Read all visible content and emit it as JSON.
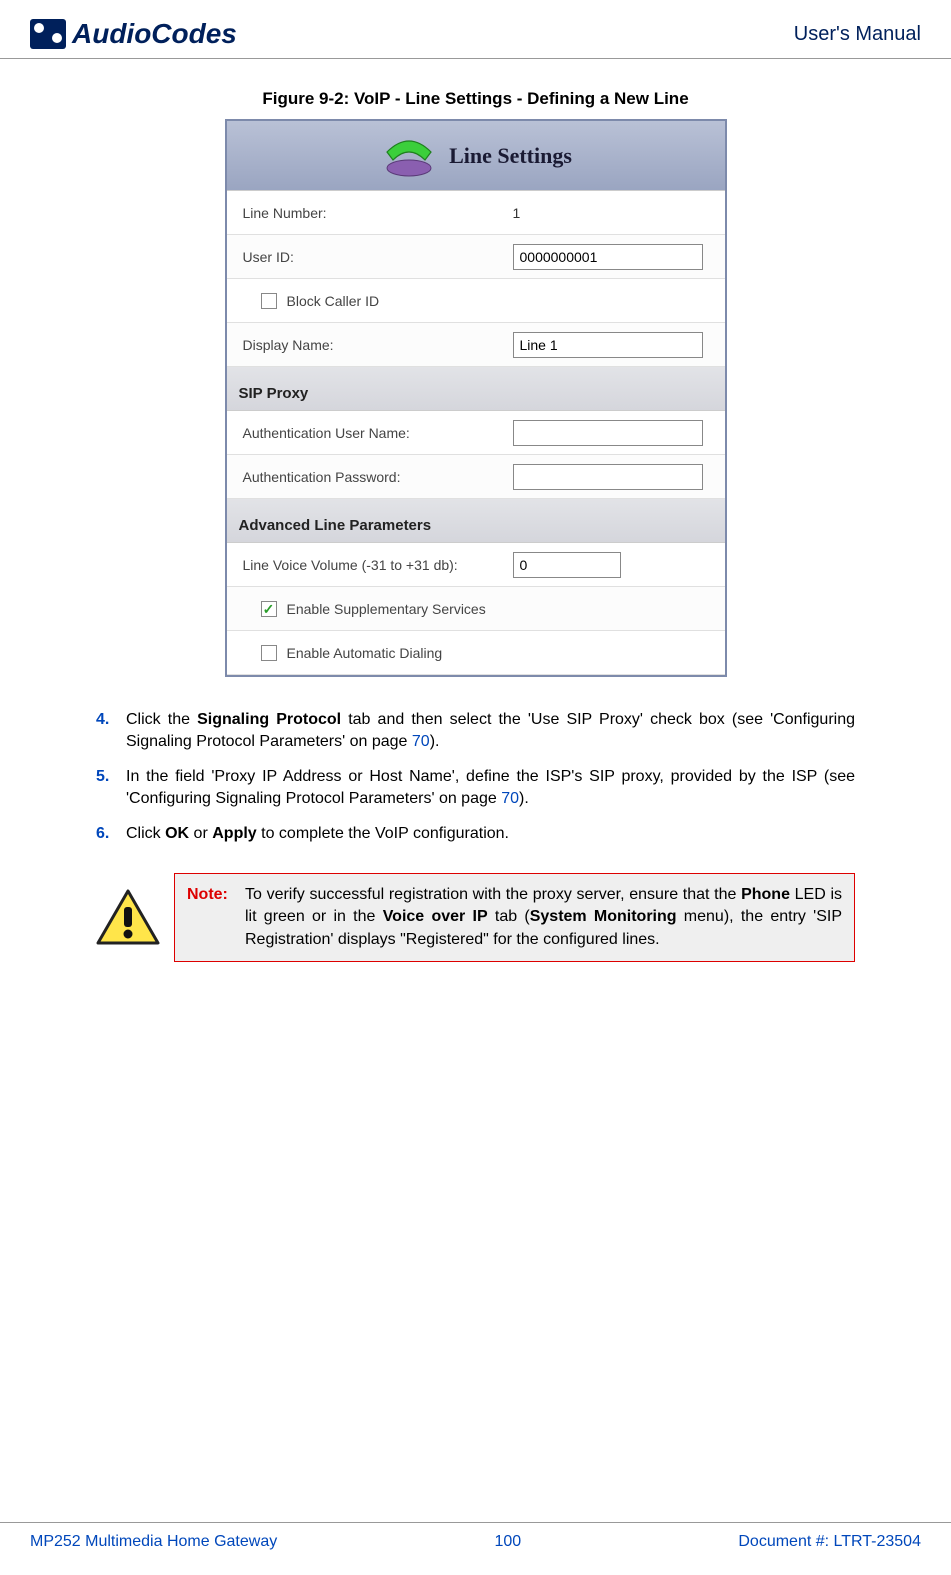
{
  "header": {
    "brand": "AudioCodes",
    "manual": "User's Manual"
  },
  "figure_caption": "Figure 9-2: VoIP - Line Settings - Defining a New Line",
  "screenshot": {
    "title": "Line Settings",
    "rows": {
      "line_number_label": "Line Number:",
      "line_number_value": "1",
      "user_id_label": "User ID:",
      "user_id_value": "0000000001",
      "block_caller_id_label": "Block Caller ID",
      "display_name_label": "Display Name:",
      "display_name_value": "Line 1"
    },
    "section_sip": "SIP Proxy",
    "sip": {
      "auth_user_label": "Authentication User Name:",
      "auth_user_value": "",
      "auth_pass_label": "Authentication Password:",
      "auth_pass_value": ""
    },
    "section_adv": "Advanced Line Parameters",
    "adv": {
      "volume_label": "Line Voice Volume (-31 to +31 db):",
      "volume_value": "0",
      "supp_services_label": "Enable Supplementary Services",
      "auto_dial_label": "Enable Automatic Dialing"
    }
  },
  "steps": {
    "s4_num": "4.",
    "s4_a": "Click the ",
    "s4_b": "Signaling Protocol",
    "s4_c": " tab and then select the 'Use SIP Proxy' check box (see 'Configuring Signaling Protocol Parameters' on page ",
    "s4_link": "70",
    "s4_d": ").",
    "s5_num": "5.",
    "s5_a": "In the field 'Proxy IP Address or Host Name', define the ISP's SIP proxy, provided by the ISP (see 'Configuring Signaling Protocol Parameters' on page ",
    "s5_link": "70",
    "s5_b": ").",
    "s6_num": "6.",
    "s6_a": "Click ",
    "s6_b": "OK",
    "s6_c": " or ",
    "s6_d": "Apply",
    "s6_e": " to complete the VoIP configuration."
  },
  "note": {
    "label": "Note:",
    "a": "To verify successful registration with the proxy server, ensure that the ",
    "b": "Phone",
    "c": " LED is lit green or in the ",
    "d": "Voice over IP",
    "e": " tab (",
    "f": "System Monitoring",
    "g": " menu), the entry 'SIP Registration' displays \"Registered\" for the configured lines."
  },
  "footer": {
    "left": "MP252 Multimedia Home Gateway",
    "center": "100",
    "right": "Document #: LTRT-23504"
  }
}
